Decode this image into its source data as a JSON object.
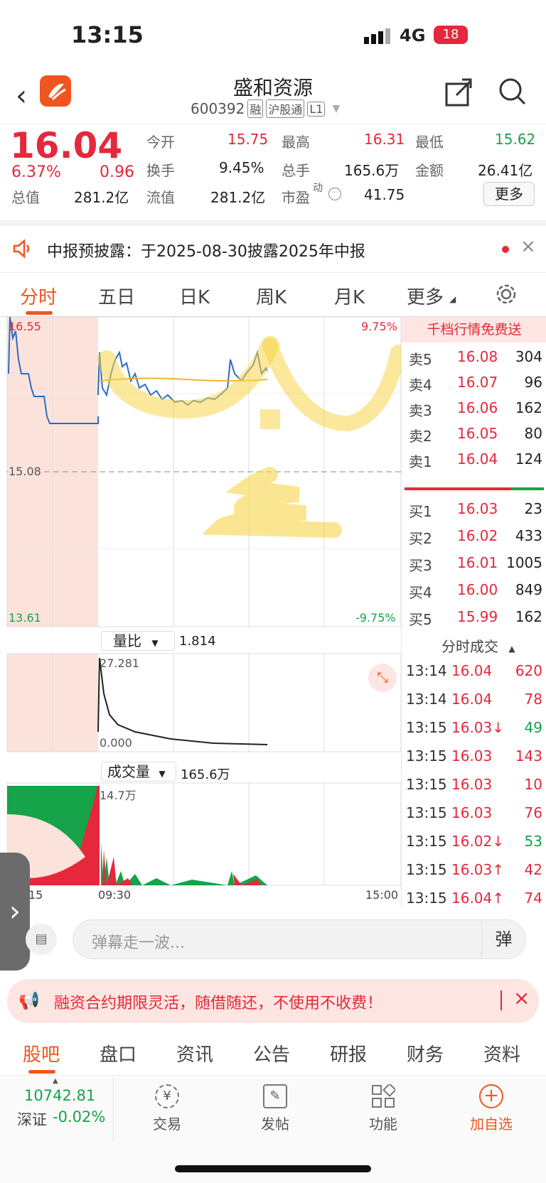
{
  "status_bar": {
    "time": "13:15",
    "network": "4G",
    "battery": "18"
  },
  "header": {
    "title": "盛和资源",
    "code": "600392",
    "tags": [
      "融",
      "沪股通",
      "L1"
    ]
  },
  "quote": {
    "price": "16.04",
    "change_pct": "6.37%",
    "change_amt": "0.96",
    "stats": [
      {
        "label": "今开",
        "value": "15.75"
      },
      {
        "label": "最高",
        "value": "16.31"
      },
      {
        "label": "最低",
        "value": "15.62"
      },
      {
        "label": "换手",
        "value": "9.45%"
      },
      {
        "label": "总手",
        "value": "165.6万"
      },
      {
        "label": "金额",
        "value": "26.41亿"
      },
      {
        "label": "总值",
        "value": "281.2亿"
      },
      {
        "label": "流值",
        "value": "281.2亿"
      },
      {
        "label": "市盈",
        "value": "41.75"
      }
    ],
    "pe_superscript": "动",
    "more_label": "更多"
  },
  "notice": {
    "text": "中报预披露：于2025-08-30披露2025年中报"
  },
  "tabs": [
    "分时",
    "五日",
    "日K",
    "周K",
    "月K",
    "更多"
  ],
  "chart": {
    "upper_price": "16.55",
    "lower_price": "13.61",
    "ref_price": "15.08",
    "upper_pct": "9.75%",
    "lower_pct": "-9.75%",
    "vol_ratio_label": "量比",
    "vol_ratio_value": "1.814",
    "vr_max": "27.281",
    "vr_min": "0.000",
    "volume_label": "成交量",
    "volume_value": "165.6万",
    "volume_max": "14.7万",
    "time_start": "15",
    "time_mid": "09:30",
    "time_end": "15:00"
  },
  "orderbook": {
    "promo": "千档行情免费送",
    "asks": [
      {
        "label": "卖5",
        "price": "16.08",
        "vol": "304"
      },
      {
        "label": "卖4",
        "price": "16.07",
        "vol": "96"
      },
      {
        "label": "卖3",
        "price": "16.06",
        "vol": "162"
      },
      {
        "label": "卖2",
        "price": "16.05",
        "vol": "80"
      },
      {
        "label": "卖1",
        "price": "16.04",
        "vol": "124"
      }
    ],
    "bids": [
      {
        "label": "买1",
        "price": "16.03",
        "vol": "23"
      },
      {
        "label": "买2",
        "price": "16.02",
        "vol": "433"
      },
      {
        "label": "买3",
        "price": "16.01",
        "vol": "1005"
      },
      {
        "label": "买4",
        "price": "16.00",
        "vol": "849"
      },
      {
        "label": "买5",
        "price": "15.99",
        "vol": "162"
      }
    ],
    "trades_title": "分时成交",
    "trades": [
      {
        "time": "13:14",
        "price": "16.04",
        "vol": "620",
        "dir": "up"
      },
      {
        "time": "13:14",
        "price": "16.04",
        "vol": "78",
        "dir": "up"
      },
      {
        "time": "13:15",
        "price": "16.03↓",
        "vol": "49",
        "dir": "down"
      },
      {
        "time": "13:15",
        "price": "16.03",
        "vol": "143",
        "dir": "up"
      },
      {
        "time": "13:15",
        "price": "16.03",
        "vol": "10",
        "dir": "up"
      },
      {
        "time": "13:15",
        "price": "16.03",
        "vol": "76",
        "dir": "up"
      },
      {
        "time": "13:15",
        "price": "16.02↓",
        "vol": "53",
        "dir": "down"
      },
      {
        "time": "13:15",
        "price": "16.03↑",
        "vol": "42",
        "dir": "up"
      },
      {
        "time": "13:15",
        "price": "16.04↑",
        "vol": "74",
        "dir": "up"
      }
    ]
  },
  "danmu": {
    "placeholder": "弹幕走一波...",
    "button": "弹"
  },
  "promo": {
    "text": "融资合约期限灵活，随借随还，不使用不收费！"
  },
  "bottom_tabs": [
    "股吧",
    "盘口",
    "资讯",
    "公告",
    "研报",
    "财务",
    "资料"
  ],
  "bottom_bar": {
    "index_value": "10742.81",
    "index_name": "深证",
    "index_change": "-0.02%",
    "items": [
      "交易",
      "发帖",
      "功能",
      "加自选"
    ]
  },
  "colors": {
    "accent": "#f0551f",
    "up": "#e5283b",
    "down": "#16a34a",
    "line": "#2b6cc4",
    "avg": "#f0b429"
  }
}
